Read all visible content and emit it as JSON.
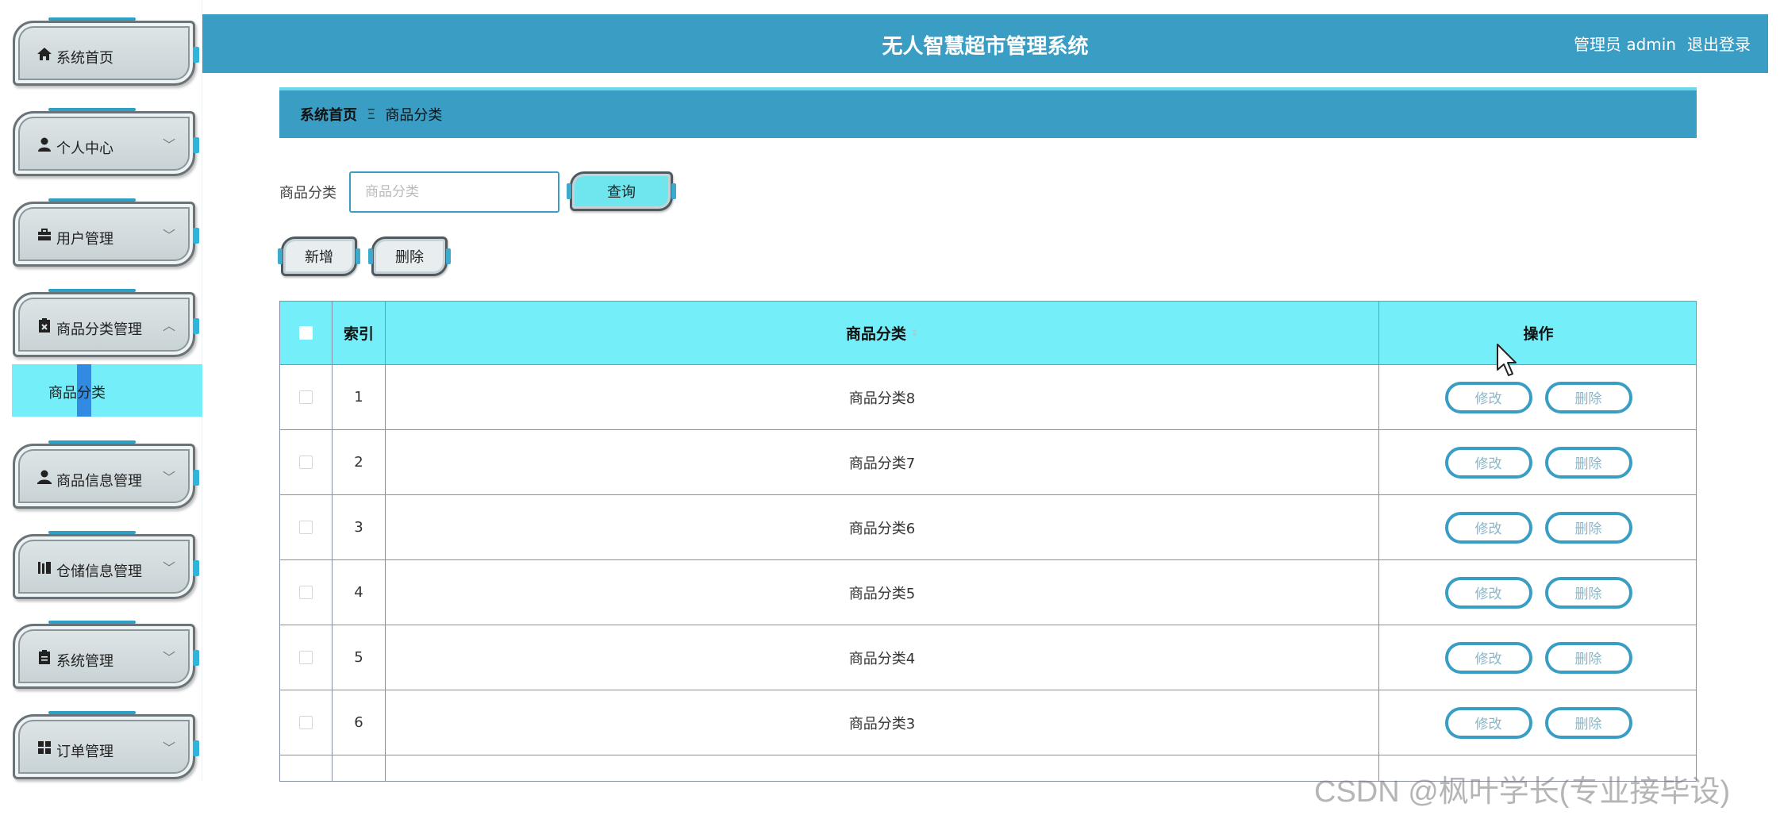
{
  "header": {
    "title": "无人智慧超市管理系统",
    "user_label": "管理员 admin",
    "logout_label": "退出登录"
  },
  "sidebar": {
    "items": [
      {
        "label": "系统首页",
        "icon": "home-icon",
        "has_chevron": false
      },
      {
        "label": "个人中心",
        "icon": "user-icon",
        "has_chevron": true
      },
      {
        "label": "用户管理",
        "icon": "briefcase-icon",
        "has_chevron": true
      },
      {
        "label": "商品分类管理",
        "icon": "clipboard-x-icon",
        "has_chevron": true,
        "expanded": true
      },
      {
        "label": "商品信息管理",
        "icon": "user-icon",
        "has_chevron": true
      },
      {
        "label": "仓储信息管理",
        "icon": "library-icon",
        "has_chevron": true
      },
      {
        "label": "系统管理",
        "icon": "clipboard-icon",
        "has_chevron": true
      },
      {
        "label": "订单管理",
        "icon": "grid-icon",
        "has_chevron": true
      }
    ],
    "sub_item": {
      "label": "商品分类",
      "active": true
    }
  },
  "breadcrumb": {
    "home": "系统首页",
    "separator": "Ξ",
    "current": "商品分类"
  },
  "search": {
    "label": "商品分类",
    "placeholder": "商品分类",
    "value": "",
    "button": "查询"
  },
  "actions": {
    "add": "新增",
    "delete": "删除"
  },
  "table": {
    "columns": [
      "索引",
      "商品分类",
      "操作"
    ],
    "rows": [
      {
        "index": "1",
        "category": "商品分类8"
      },
      {
        "index": "2",
        "category": "商品分类7"
      },
      {
        "index": "3",
        "category": "商品分类6"
      },
      {
        "index": "4",
        "category": "商品分类5"
      },
      {
        "index": "5",
        "category": "商品分类4"
      },
      {
        "index": "6",
        "category": "商品分类3"
      }
    ],
    "edit_label": "修改",
    "delete_label": "删除"
  },
  "watermark": "CSDN @枫叶学长(专业接毕设)",
  "colors": {
    "primary": "#3a9ec4",
    "header_row": "#74eef8",
    "sub_active": "#74eef8"
  }
}
